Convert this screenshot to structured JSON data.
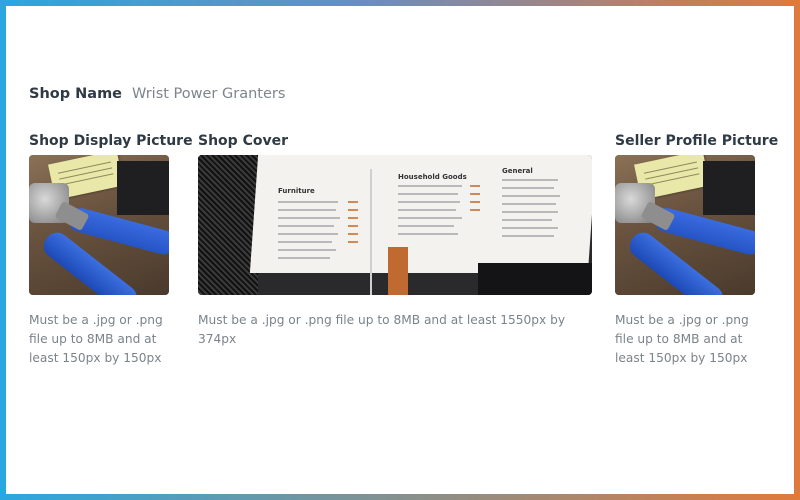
{
  "shop_name": {
    "label": "Shop Name",
    "value": "Wrist Power Granters"
  },
  "display_picture": {
    "title": "Shop Display Picture",
    "hint": "Must be a .jpg or .png file up to 8MB and at least 150px by 150px"
  },
  "cover": {
    "title": "Shop Cover",
    "hint": "Must be a .jpg or .png file up to 8MB and at least 1550px by 374px"
  },
  "seller_profile": {
    "title": "Seller Profile Picture",
    "hint": "Must be a .jpg or .png file up to 8MB and at least 150px by 150px"
  },
  "colors": {
    "frame_left": "#2aa7e0",
    "frame_right": "#e07a3c",
    "text_dark": "#2f3a45",
    "text_muted": "#7b838a"
  }
}
